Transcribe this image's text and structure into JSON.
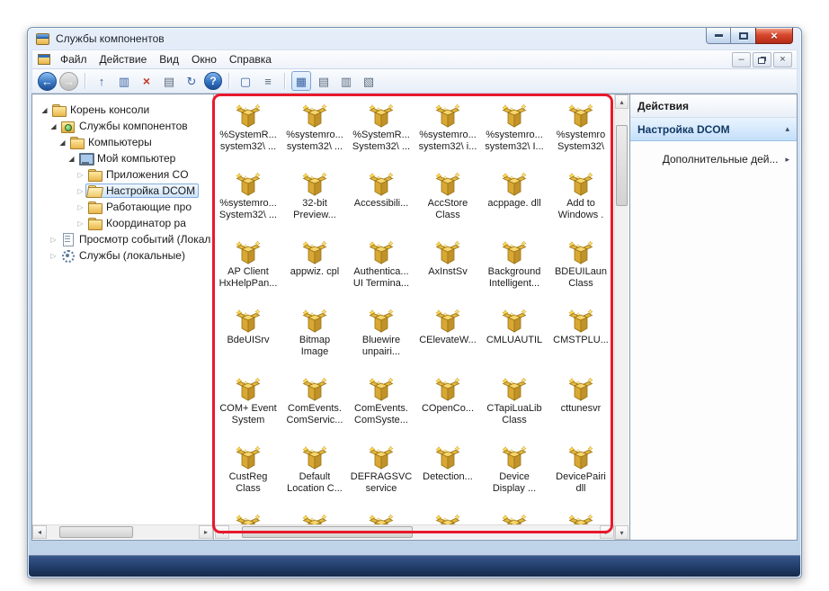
{
  "window": {
    "title": "Службы компонентов",
    "close_glyph": "×",
    "minimize_glyph": "–"
  },
  "menubar": {
    "items": [
      {
        "label": "Файл"
      },
      {
        "label": "Действие"
      },
      {
        "label": "Вид"
      },
      {
        "label": "Окно"
      },
      {
        "label": "Справка"
      }
    ]
  },
  "toolbar": {
    "buttons": [
      {
        "name": "back",
        "glyph": "←"
      },
      {
        "name": "forward",
        "glyph": "→"
      },
      {
        "name": "up-one-level",
        "glyph": "↑"
      },
      {
        "name": "show-console-tree",
        "glyph": "▥"
      },
      {
        "name": "delete",
        "glyph": "×"
      },
      {
        "name": "properties",
        "glyph": "▤"
      },
      {
        "name": "refresh",
        "glyph": "↻"
      },
      {
        "name": "help",
        "glyph": "?"
      },
      {
        "name": "new-window",
        "glyph": "▢"
      },
      {
        "name": "export-list",
        "glyph": "≡"
      },
      {
        "name": "view-large-icons",
        "glyph": "▦"
      },
      {
        "name": "view-small-icons",
        "glyph": "▤"
      },
      {
        "name": "view-list",
        "glyph": "▥"
      },
      {
        "name": "view-details",
        "glyph": "▧"
      }
    ]
  },
  "tree": {
    "items": [
      {
        "label": "Корень консоли",
        "level": 0,
        "exp": "◢",
        "expander": "expanded",
        "icon": "folder",
        "selected": ""
      },
      {
        "label": "Службы компонентов",
        "level": 1,
        "exp": "◢",
        "expander": "expanded",
        "icon": "comps",
        "selected": ""
      },
      {
        "label": "Компьютеры",
        "level": 2,
        "exp": "◢",
        "expander": "expanded",
        "icon": "folder",
        "selected": ""
      },
      {
        "label": "Мой компьютер",
        "level": 3,
        "exp": "◢",
        "expander": "expanded",
        "icon": "computer",
        "selected": ""
      },
      {
        "label": "Приложения CO",
        "level": 4,
        "exp": "▷",
        "expander": "collapsed",
        "icon": "folder",
        "selected": ""
      },
      {
        "label": "Настройка DCOM",
        "level": 4,
        "exp": "▷",
        "expander": "collapsed",
        "icon": "folder-open",
        "selected": "selected"
      },
      {
        "label": "Работающие про",
        "level": 4,
        "exp": "▷",
        "expander": "collapsed",
        "icon": "folder",
        "selected": ""
      },
      {
        "label": "Координатор ра",
        "level": 4,
        "exp": "▷",
        "expander": "collapsed",
        "icon": "folder",
        "selected": ""
      },
      {
        "label": "Просмотр событий (Локал",
        "level": 1,
        "exp": "▷",
        "expander": "collapsed",
        "icon": "events",
        "selected": ""
      },
      {
        "label": "Службы (локальные)",
        "level": 1,
        "exp": "▷",
        "expander": "collapsed",
        "icon": "services",
        "selected": ""
      }
    ]
  },
  "grid": {
    "items": [
      {
        "line1": "%SystemR...",
        "line2": "system32\\ ..."
      },
      {
        "line1": "%systemro...",
        "line2": "system32\\ ..."
      },
      {
        "line1": "%SystemR...",
        "line2": "System32\\ ..."
      },
      {
        "line1": "%systemro...",
        "line2": "system32\\ i..."
      },
      {
        "line1": "%systemro...",
        "line2": "system32\\ I..."
      },
      {
        "line1": "%systemro",
        "line2": "System32\\"
      },
      {
        "line1": "%systemro...",
        "line2": "System32\\ ..."
      },
      {
        "line1": "32-bit",
        "line2": "Preview..."
      },
      {
        "line1": "Accessibili...",
        "line2": ""
      },
      {
        "line1": "AccStore",
        "line2": "Class"
      },
      {
        "line1": "acppage. dll",
        "line2": ""
      },
      {
        "line1": "Add to",
        "line2": "Windows ."
      },
      {
        "line1": "AP Client",
        "line2": "HxHelpPan..."
      },
      {
        "line1": "appwiz. cpl",
        "line2": ""
      },
      {
        "line1": "Authentica...",
        "line2": "UI Termina..."
      },
      {
        "line1": "AxInstSv",
        "line2": ""
      },
      {
        "line1": "Background",
        "line2": "Intelligent..."
      },
      {
        "line1": "BDEUILaun",
        "line2": "Class"
      },
      {
        "line1": "BdeUISrv",
        "line2": ""
      },
      {
        "line1": "Bitmap",
        "line2": "Image"
      },
      {
        "line1": "Bluewire",
        "line2": "unpairi..."
      },
      {
        "line1": "CElevateW...",
        "line2": ""
      },
      {
        "line1": "CMLUAUTIL",
        "line2": ""
      },
      {
        "line1": "CMSTPLU...",
        "line2": ""
      },
      {
        "line1": "COM+ Event",
        "line2": "System"
      },
      {
        "line1": "ComEvents.",
        "line2": "ComServic..."
      },
      {
        "line1": "ComEvents.",
        "line2": "ComSyste..."
      },
      {
        "line1": "COpenCo...",
        "line2": ""
      },
      {
        "line1": "CTapiLuaLib",
        "line2": "Class"
      },
      {
        "line1": "cttunesvr",
        "line2": ""
      },
      {
        "line1": "CustReg",
        "line2": "Class"
      },
      {
        "line1": "Default",
        "line2": "Location C..."
      },
      {
        "line1": "DEFRAGSVC",
        "line2": "service"
      },
      {
        "line1": "Detection...",
        "line2": ""
      },
      {
        "line1": "Device",
        "line2": "Display ..."
      },
      {
        "line1": "DevicePairi",
        "line2": "dll"
      },
      {
        "line1": "",
        "line2": ""
      },
      {
        "line1": "",
        "line2": ""
      },
      {
        "line1": "",
        "line2": ""
      },
      {
        "line1": "",
        "line2": ""
      },
      {
        "line1": "",
        "line2": ""
      },
      {
        "line1": "",
        "line2": ""
      }
    ]
  },
  "actions": {
    "title": "Действия",
    "rows": [
      {
        "label": "Настройка DCOM",
        "arrow": "▴"
      },
      {
        "label": "Дополнительные дей...",
        "arrow": "▸"
      }
    ]
  },
  "scrollbar_glyphs": {
    "up": "▴",
    "down": "▾",
    "left": "◂",
    "right": "▸"
  }
}
